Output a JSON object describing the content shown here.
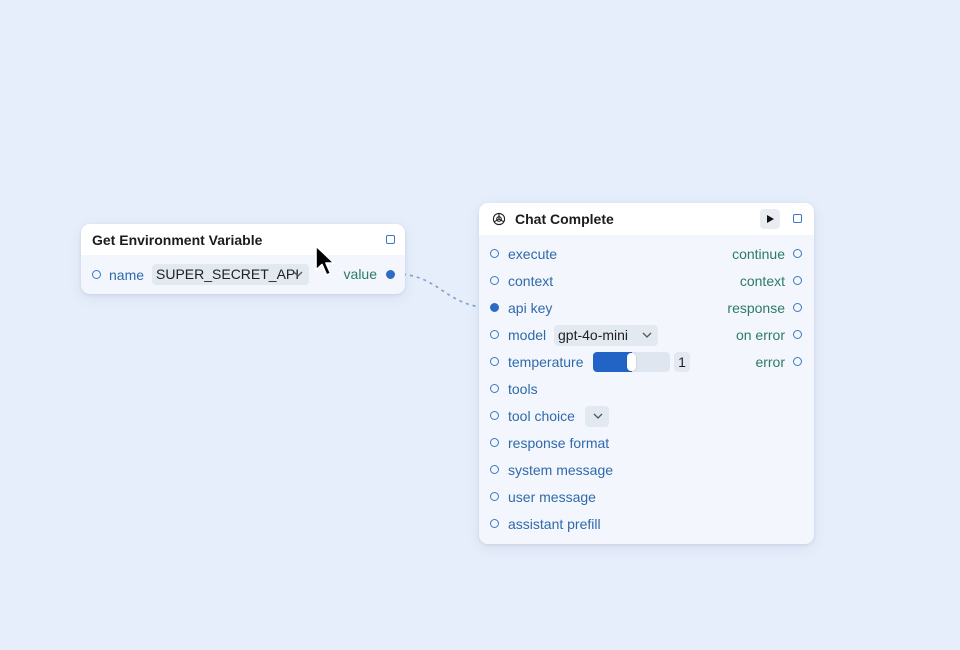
{
  "nodes": {
    "env_var": {
      "title": "Get Environment Variable",
      "input": {
        "label": "name",
        "value": "SUPER_SECRET_API"
      },
      "output": {
        "label": "value"
      }
    },
    "chat": {
      "title": "Chat Complete",
      "icon": "openai-icon",
      "inputs": [
        {
          "label": "execute"
        },
        {
          "label": "context"
        },
        {
          "label": "api key"
        },
        {
          "label": "model"
        },
        {
          "label": "temperature"
        },
        {
          "label": "tools"
        },
        {
          "label": "tool choice"
        },
        {
          "label": "response format"
        },
        {
          "label": "system message"
        },
        {
          "label": "user message"
        },
        {
          "label": "assistant prefill"
        }
      ],
      "outputs": [
        {
          "label": "continue"
        },
        {
          "label": "context"
        },
        {
          "label": "response"
        },
        {
          "label": "on error"
        },
        {
          "label": "error"
        }
      ],
      "model_value": "gpt-4o-mini",
      "tool_choice_value": "",
      "temperature": {
        "value": "1",
        "level": 0.5
      }
    }
  },
  "colors": {
    "background": "#e6eefb",
    "input_label": "#2f69aa",
    "output_label": "#2c7a68",
    "accent": "#2264c6"
  }
}
